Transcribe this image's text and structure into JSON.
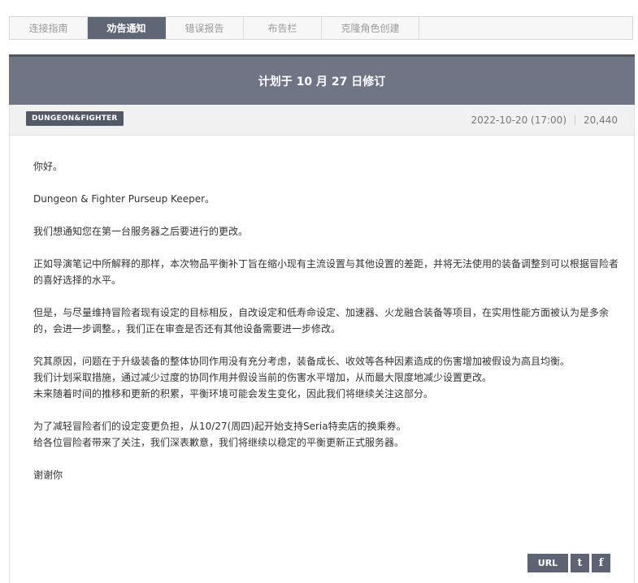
{
  "tabs": [
    {
      "label": "连接指南",
      "active": false
    },
    {
      "label": "劝告通知",
      "active": true
    },
    {
      "label": "错误报告",
      "active": false
    },
    {
      "label": "布告栏",
      "active": false
    },
    {
      "label": "克隆角色创建",
      "active": false
    }
  ],
  "article": {
    "title": "计划于 10 月 27 日修订",
    "tag": "DUNGEON&FIGHTER",
    "date": "2022-10-20 (17:00)",
    "views": "20,440",
    "paragraphs": [
      [
        "你好。"
      ],
      [
        "Dungeon & Fighter Purseup Keeper。"
      ],
      [
        "我们想通知您在第一台服务器之后要进行的更改。"
      ],
      [
        "正如导演笔记中所解释的那样，本次物品平衡补丁旨在缩小现有主流设置与其他设置的差距，并将无法使用的装备调整到可以根据冒险者的喜好选择的水平。"
      ],
      [
        "但是，与尽量维持冒险者现有设定的目标相反，自改设定和低寿命设定、加速器、火龙融合装备等项目，在实用性能方面被认为是多余的，会进一步调整。，我们正在审查是否还有其他设备需要进一步修改。"
      ],
      [
        "究其原因，问题在于升级装备的整体协同作用没有充分考虑，装备成长、收效等各种因素造成的伤害增加被假设为高且均衡。",
        "我们计划采取措施，通过减少过度的协同作用并假设当前的伤害水平增加，从而最大限度地减少设置更改。",
        "未来随着时间的推移和更新的积累，平衡环境可能会发生变化，因此我们将继续关注这部分。"
      ],
      [
        "为了减轻冒险者们的设定变更负担，从10/27(周四)起开始支持Seria特卖店的换乘券。",
        "给各位冒险者带来了关注，我们深表歉意，我们将继续以稳定的平衡更新正式服务器。"
      ],
      [
        "谢谢你"
      ]
    ]
  },
  "share": {
    "url_label": "URL",
    "twitter_glyph": "t",
    "facebook_glyph": "f",
    "icons": [
      "twitter-icon",
      "facebook-icon"
    ]
  }
}
